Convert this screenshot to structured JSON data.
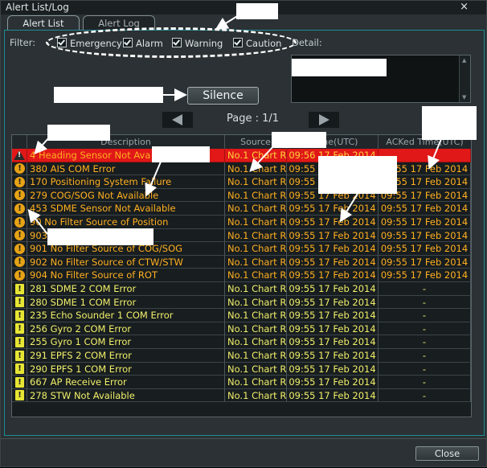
{
  "window": {
    "title": "Alert List/Log",
    "close_glyph": "×"
  },
  "tabs": [
    {
      "label": "Alert List",
      "active": true
    },
    {
      "label": "Alert Log",
      "active": false
    }
  ],
  "filter": {
    "label": "Filter:",
    "options": [
      {
        "label": "Emergency",
        "checked": true
      },
      {
        "label": "Alarm",
        "checked": true
      },
      {
        "label": "Warning",
        "checked": true
      },
      {
        "label": "Caution",
        "checked": true
      }
    ]
  },
  "detail": {
    "label": "Detail:"
  },
  "silence_label": "Silence",
  "page_indicator": "Page : 1/1",
  "table": {
    "headers": [
      "Description",
      "Source",
      "l Time(UTC)",
      "ACKed Time(UTC)"
    ],
    "rows": [
      {
        "icon": "alarm-triangle-icon",
        "level": "alarm",
        "desc": "4 Heading Sensor Not Ava",
        "source": "No.1 Chart R..",
        "time": "09:56 17 Feb 2014",
        "acked": ""
      },
      {
        "icon": "warning-circle-icon",
        "level": "warning",
        "desc": "380 AIS COM Error",
        "source": "No.1 Chart R..",
        "time": "09:55 17 Feb 2014",
        "acked": "09:55 17 Feb 2014"
      },
      {
        "icon": "warning-circle-icon",
        "level": "warning",
        "desc": "170 Positioning System Failure",
        "source": "No.1 Chart R..",
        "time": "09:55 17 Feb 2014",
        "acked": "09:55 17 Feb 2014"
      },
      {
        "icon": "warning-circle-icon",
        "level": "warning",
        "desc": "279 COG/SOG Not Available",
        "source": "No.1 Chart R..",
        "time": "09:55 17 Feb 2014",
        "acked": "09:55 17 Feb 2014"
      },
      {
        "icon": "warning-circle-icon",
        "level": "warning",
        "desc": "453 SDME Sensor Not Available",
        "source": "No.1 Chart R..",
        "time": "09:55 17 Feb 2014",
        "acked": "09:55 17 Feb 2014"
      },
      {
        "icon": "warning-circle-icon",
        "level": "warning",
        "desc": "90 No Filter Source of Position",
        "source": "No.1 Chart R..",
        "time": "09:55 17 Feb 2014",
        "acked": "09:55 17 Feb 2014"
      },
      {
        "icon": "warning-circle-icon",
        "level": "warning",
        "desc": "903",
        "source": "No.1 Chart R..",
        "time": "09:55 17 Feb 2014",
        "acked": "09:55 17 Feb 2014"
      },
      {
        "icon": "warning-circle-icon",
        "level": "warning",
        "desc": "901 No Filter Source of COG/SOG",
        "source": "No.1 Chart R..",
        "time": "09:55 17 Feb 2014",
        "acked": "09:55 17 Feb 2014"
      },
      {
        "icon": "warning-circle-icon",
        "level": "warning",
        "desc": "902 No Filter Source of CTW/STW",
        "source": "No.1 Chart R..",
        "time": "09:55 17 Feb 2014",
        "acked": "09:55 17 Feb 2014"
      },
      {
        "icon": "warning-circle-icon",
        "level": "warning",
        "desc": "904 No Filter Source of ROT",
        "source": "No.1 Chart R..",
        "time": "09:55 17 Feb 2014",
        "acked": "09:55 17 Feb 2014"
      },
      {
        "icon": "caution-square-icon",
        "level": "caution",
        "desc": "281 SDME 2 COM Error",
        "source": "No.1 Chart R..",
        "time": "09:55 17 Feb 2014",
        "acked": "-"
      },
      {
        "icon": "caution-square-icon",
        "level": "caution",
        "desc": "280 SDME 1 COM Error",
        "source": "No.1 Chart R..",
        "time": "09:55 17 Feb 2014",
        "acked": "-"
      },
      {
        "icon": "caution-square-icon",
        "level": "caution",
        "desc": "235 Echo Sounder 1 COM Error",
        "source": "No.1 Chart R..",
        "time": "09:55 17 Feb 2014",
        "acked": "-"
      },
      {
        "icon": "caution-square-icon",
        "level": "caution",
        "desc": "256 Gyro 2 COM Error",
        "source": "No.1 Chart R..",
        "time": "09:55 17 Feb 2014",
        "acked": "-"
      },
      {
        "icon": "caution-square-icon",
        "level": "caution",
        "desc": "255 Gyro 1 COM Error",
        "source": "No.1 Chart R..",
        "time": "09:55 17 Feb 2014",
        "acked": "-"
      },
      {
        "icon": "caution-square-icon",
        "level": "caution",
        "desc": "291 EPFS 2 COM Error",
        "source": "No.1 Chart R..",
        "time": "09:55 17 Feb 2014",
        "acked": "-"
      },
      {
        "icon": "caution-square-icon",
        "level": "caution",
        "desc": "290 EPFS 1 COM Error",
        "source": "No.1 Chart R..",
        "time": "09:55 17 Feb 2014",
        "acked": "-"
      },
      {
        "icon": "caution-square-icon",
        "level": "caution",
        "desc": "667 AP Receive Error",
        "source": "No.1 Chart R..",
        "time": "09:55 17 Feb 2014",
        "acked": "-"
      },
      {
        "icon": "caution-square-icon",
        "level": "caution",
        "desc": "278 STW Not Available",
        "source": "No.1 Chart R..",
        "time": "09:55 17 Feb 2014",
        "acked": "-"
      }
    ]
  },
  "close_label": "Close",
  "colors": {
    "alarm_row_bg": "#e01818",
    "warning_text": "#ffb020",
    "caution_text": "#f0f06a",
    "panel_border": "#1f8d95"
  }
}
